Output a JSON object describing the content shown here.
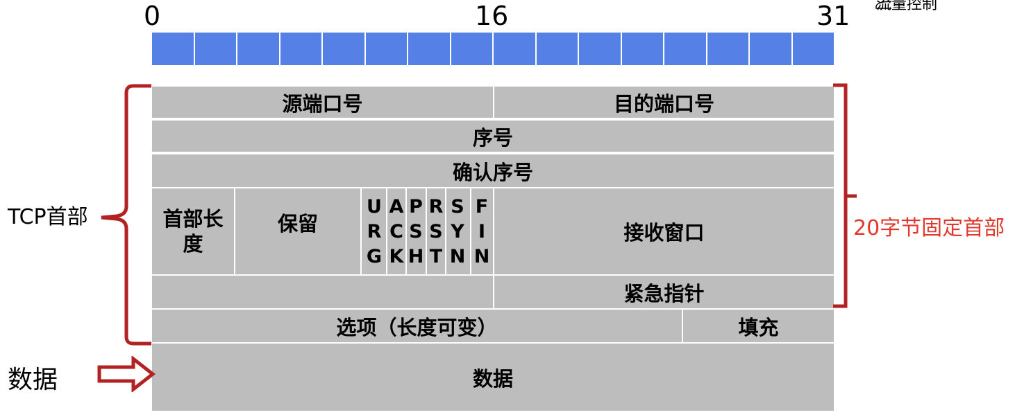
{
  "bit_labels": {
    "start": "0",
    "mid": "16",
    "end": "31"
  },
  "corner_text": "流量控制",
  "fields": {
    "src_port": "源端口号",
    "dst_port": "目的端口号",
    "seq": "序号",
    "ack": "确认序号",
    "header_len_line1": "首部长",
    "header_len_line2": "度",
    "reserved": "保留",
    "flags": [
      [
        "U",
        "R",
        "G"
      ],
      [
        "A",
        "C",
        "K"
      ],
      [
        "P",
        "S",
        "H"
      ],
      [
        "R",
        "S",
        "T"
      ],
      [
        "S",
        "Y",
        "N"
      ],
      [
        "F",
        "I",
        "N"
      ]
    ],
    "window": "接收窗口",
    "checksum": "",
    "urgent_ptr": "紧急指针",
    "options": "选项（长度可变）",
    "padding": "填充",
    "data": "数据"
  },
  "labels": {
    "tcp_header": "TCP首部",
    "data_left": "数据",
    "fixed_header": "20字节固定首部"
  },
  "colors": {
    "ruler": "#5580e6",
    "field_bg": "#bdbdbd",
    "bracket": "#b22222",
    "arrow": "#b22222",
    "red_text": "#e03a2e"
  }
}
